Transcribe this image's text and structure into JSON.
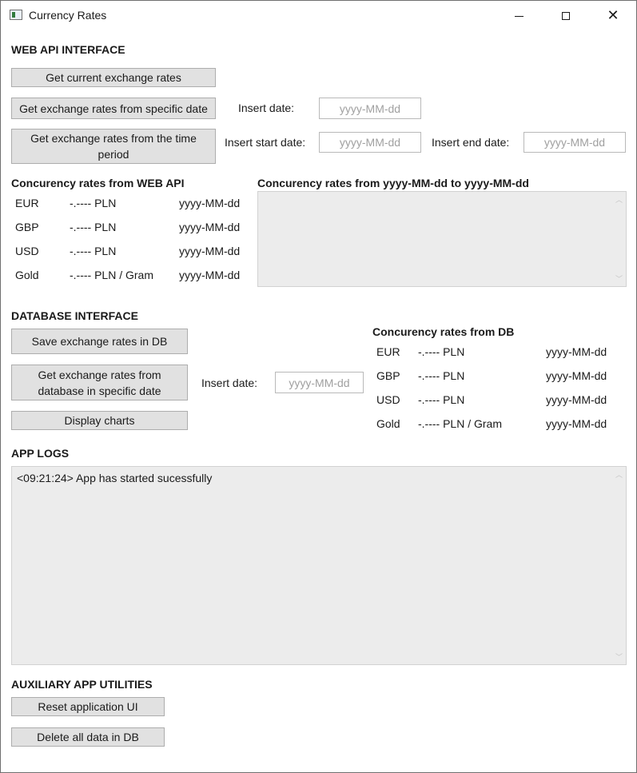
{
  "window": {
    "title": "Currency Rates"
  },
  "web_api": {
    "heading": "WEB API INTERFACE",
    "btn_current": "Get current exchange rates",
    "btn_specific": "Get exchange rates from specific date",
    "btn_period": "Get exchange rates from the time period",
    "insert_date_label": "Insert date:",
    "insert_start_label": "Insert start date:",
    "insert_end_label": "Insert end date:",
    "date_placeholder": "yyyy-MM-dd",
    "rates_heading": "Concurency rates from WEB API",
    "range_heading": "Concurency rates from yyyy-MM-dd to yyyy-MM-dd",
    "rates": [
      {
        "code": "EUR",
        "value": "-.---- PLN",
        "date": "yyyy-MM-dd"
      },
      {
        "code": "GBP",
        "value": "-.---- PLN",
        "date": "yyyy-MM-dd"
      },
      {
        "code": "USD",
        "value": "-.---- PLN",
        "date": "yyyy-MM-dd"
      },
      {
        "code": "Gold",
        "value": "-.---- PLN / Gram",
        "date": "yyyy-MM-dd"
      }
    ]
  },
  "database": {
    "heading": "DATABASE INTERFACE",
    "btn_save": "Save exchange rates in DB",
    "btn_get_specific": "Get exchange rates from database in specific date",
    "btn_charts": "Display charts",
    "insert_date_label": "Insert date:",
    "date_placeholder": "yyyy-MM-dd",
    "rates_heading": "Concurency rates from DB",
    "rates": [
      {
        "code": "EUR",
        "value": "-.---- PLN",
        "date": "yyyy-MM-dd"
      },
      {
        "code": "GBP",
        "value": "-.---- PLN",
        "date": "yyyy-MM-dd"
      },
      {
        "code": "USD",
        "value": "-.---- PLN",
        "date": "yyyy-MM-dd"
      },
      {
        "code": "Gold",
        "value": "-.---- PLN / Gram",
        "date": "yyyy-MM-dd"
      }
    ]
  },
  "logs": {
    "heading": "APP LOGS",
    "lines": [
      "<09:21:24> App has started sucessfully"
    ]
  },
  "utilities": {
    "heading": "AUXILIARY APP UTILITIES",
    "btn_reset": "Reset application UI",
    "btn_delete": "Delete all data in DB"
  }
}
